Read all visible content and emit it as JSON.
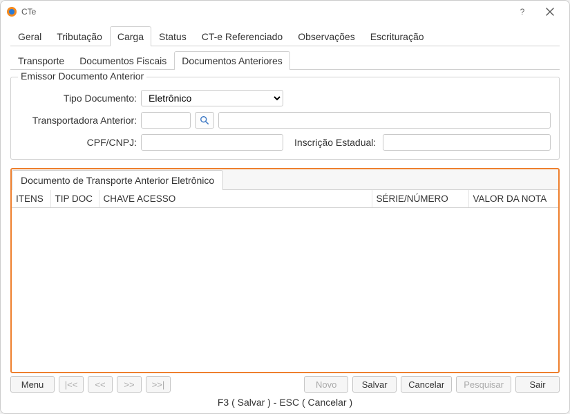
{
  "window": {
    "title": "CTe"
  },
  "main_tabs": [
    "Geral",
    "Tributação",
    "Carga",
    "Status",
    "CT-e Referenciado",
    "Observações",
    "Escrituração"
  ],
  "main_tab_active": 2,
  "sub_tabs": [
    "Transporte",
    "Documentos Fiscais",
    "Documentos Anteriores"
  ],
  "sub_tab_active": 2,
  "emissor": {
    "legend": "Emissor Documento Anterior",
    "tipo_doc_label": "Tipo Documento:",
    "tipo_doc_value": "Eletrônico",
    "transp_label": "Transportadora Anterior:",
    "transp_code": "",
    "transp_name": "",
    "cpfcnpj_label": "CPF/CNPJ:",
    "cpfcnpj_value": "",
    "ie_label": "Inscrição Estadual:",
    "ie_value": ""
  },
  "doc_panel": {
    "tab_label": "Documento de Transporte Anterior Eletrônico",
    "columns": [
      "ITENS",
      "TIP DOC",
      "CHAVE ACESSO",
      "SÉRIE/NÚMERO",
      "VALOR DA NOTA"
    ],
    "rows": []
  },
  "bottom": {
    "menu": "Menu",
    "nav_first": "|<<",
    "nav_prev": "<<",
    "nav_next": ">>",
    "nav_last": ">>|",
    "novo": "Novo",
    "salvar": "Salvar",
    "cancelar": "Cancelar",
    "pesquisar": "Pesquisar",
    "sair": "Sair"
  },
  "status": "F3 ( Salvar )  -  ESC ( Cancelar )"
}
